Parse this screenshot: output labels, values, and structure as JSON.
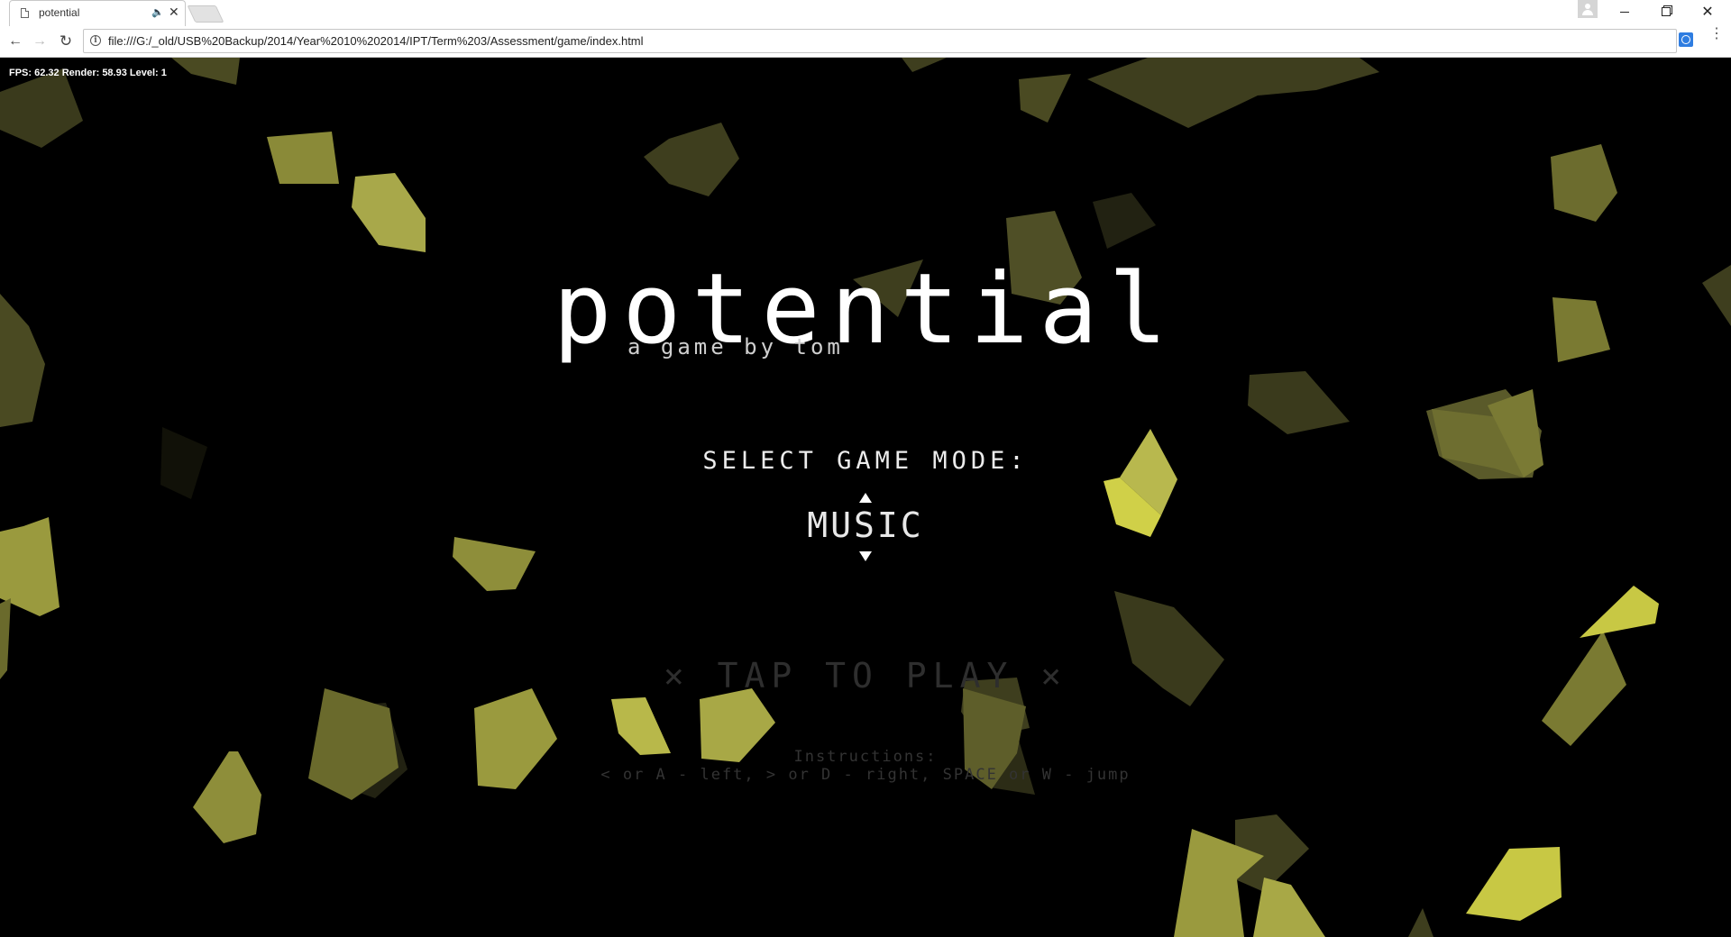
{
  "browser": {
    "tab_title": "potential",
    "url": "file:///G:/_old/USB%20Backup/2014/Year%2010%202014/IPT/Term%203/Assessment/game/index.html"
  },
  "game": {
    "debug": "FPS: 62.32  Render: 58.93  Level: 1",
    "title": "potential",
    "subtitle": "a game by tom",
    "select_label": "SELECT GAME MODE:",
    "mode": "MUSIC",
    "tap_to_play": "⨯ TAP TO PLAY ⨯",
    "instructions_heading": "Instructions:",
    "instructions_text": "< or A - left, > or D - right, SPACE or W - jump"
  },
  "colors": {
    "background": "#000000",
    "shard_bright": "#cfcf4a",
    "shard_mid": "#8a8a34",
    "shard_dim": "#3e3e1e"
  }
}
